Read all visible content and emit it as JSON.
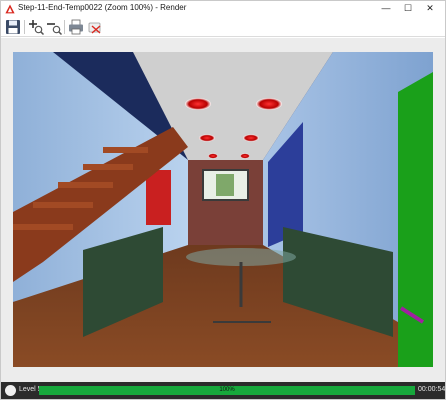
{
  "window": {
    "title": "Step-11-End-Temp0022 (Zoom 100%) - Render",
    "controls": {
      "minimize": "—",
      "maximize": "☐",
      "close": "✕"
    }
  },
  "toolbar": {
    "tools": [
      {
        "icon": "save-icon"
      },
      {
        "icon": "zoom-in-icon"
      },
      {
        "icon": "zoom-out-icon"
      },
      {
        "icon": "print-icon"
      },
      {
        "icon": "clear-icon"
      }
    ]
  },
  "status": {
    "level": "Level 5",
    "progress_text": "100%",
    "progress": 1.0,
    "elapsed": "00:00:54"
  },
  "colors": {
    "accent": "#d9281f",
    "progress": "#17a83c",
    "status_bg": "#2b2b2b"
  }
}
